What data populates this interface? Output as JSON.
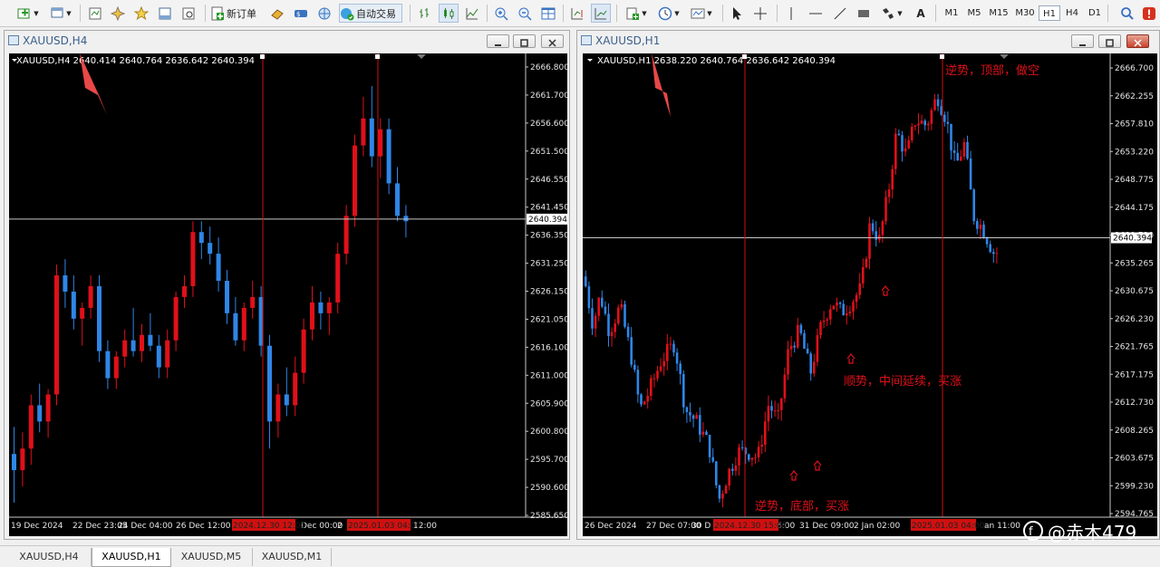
{
  "toolbar": {
    "new_order_label": "新订单",
    "auto_trading_label": "自动交易",
    "timeframes": [
      "M1",
      "M5",
      "M15",
      "M30",
      "H1",
      "H4",
      "D1"
    ],
    "active_timeframe": "H1",
    "text_tool_label": "A"
  },
  "left_window": {
    "title": "XAUUSD,H4",
    "info_line": "XAUUSD,H4  2640.414 2640.764 2636.642 2640.394",
    "current_price": "2640.394",
    "price_ticks": [
      "2666.800",
      "2661.700",
      "2656.600",
      "2651.500",
      "2646.550",
      "2641.450",
      "2636.350",
      "2631.250",
      "2626.150",
      "2621.050",
      "2616.100",
      "2611.000",
      "2605.900",
      "2600.800",
      "2595.700",
      "2590.600",
      "2585.650"
    ],
    "time_labels": [
      "19 Dec 2024",
      "22 Dec 23:05",
      "24 Dec 04:00",
      "26 Dec 12:00",
      "Dec 00:00",
      "2",
      "12:00"
    ],
    "vline_labels": [
      "2024.12.30 12:00",
      "2025.01.03 04:00"
    ],
    "y_range": [
      2585.65,
      2668.5
    ],
    "candles": [
      [
        2597,
        2602,
        2588,
        2594
      ],
      [
        2594,
        2601,
        2591,
        2598
      ],
      [
        2598,
        2608,
        2595,
        2606
      ],
      [
        2606,
        2610,
        2601,
        2603
      ],
      [
        2603,
        2609,
        2600,
        2608
      ],
      [
        2608,
        2632,
        2606,
        2630
      ],
      [
        2630,
        2633,
        2624,
        2627
      ],
      [
        2627,
        2630,
        2620,
        2622
      ],
      [
        2622,
        2625,
        2617,
        2624
      ],
      [
        2624,
        2630,
        2622,
        2628
      ],
      [
        2628,
        2630,
        2614,
        2616
      ],
      [
        2616,
        2618,
        2609,
        2611
      ],
      [
        2611,
        2616,
        2609,
        2615
      ],
      [
        2615,
        2620,
        2613,
        2618
      ],
      [
        2618,
        2624,
        2615,
        2616
      ],
      [
        2616,
        2621,
        2614,
        2619
      ],
      [
        2619,
        2623,
        2616,
        2617
      ],
      [
        2617,
        2619,
        2611,
        2613
      ],
      [
        2613,
        2620,
        2611,
        2618
      ],
      [
        2618,
        2627,
        2616,
        2626
      ],
      [
        2626,
        2630,
        2624,
        2628
      ],
      [
        2628,
        2640,
        2626,
        2638
      ],
      [
        2638,
        2640,
        2633,
        2636
      ],
      [
        2636,
        2639,
        2632,
        2634
      ],
      [
        2634,
        2637,
        2627,
        2629
      ],
      [
        2629,
        2631,
        2621,
        2623
      ],
      [
        2623,
        2626,
        2617,
        2618
      ],
      [
        2618,
        2625,
        2616,
        2624
      ],
      [
        2624,
        2629,
        2622,
        2626
      ],
      [
        2626,
        2628,
        2615,
        2617
      ],
      [
        2617,
        2619,
        2598,
        2603
      ],
      [
        2603,
        2610,
        2600,
        2608
      ],
      [
        2608,
        2613,
        2604,
        2606
      ],
      [
        2606,
        2615,
        2604,
        2612
      ],
      [
        2612,
        2622,
        2610,
        2620
      ],
      [
        2620,
        2628,
        2618,
        2625
      ],
      [
        2625,
        2627,
        2620,
        2623
      ],
      [
        2623,
        2626,
        2619,
        2625
      ],
      [
        2625,
        2636,
        2623,
        2634
      ],
      [
        2634,
        2643,
        2632,
        2641
      ],
      [
        2641,
        2656,
        2639,
        2654
      ],
      [
        2654,
        2663,
        2652,
        2659
      ],
      [
        2659,
        2665,
        2650,
        2652
      ],
      [
        2652,
        2659,
        2648,
        2657
      ],
      [
        2657,
        2659,
        2645,
        2647
      ],
      [
        2647,
        2650,
        2640,
        2641
      ],
      [
        2641,
        2643,
        2637,
        2640
      ]
    ]
  },
  "right_window": {
    "title": "XAUUSD,H1",
    "info_line": "XAUUSD,H1  2638.220 2640.764 2636.642 2640.394",
    "current_price": "2640.394",
    "price_ticks": [
      "2666.700",
      "2662.255",
      "2657.810",
      "2653.220",
      "2648.775",
      "2644.175",
      "2639.730",
      "2635.265",
      "2630.675",
      "2626.230",
      "2621.765",
      "2617.175",
      "2612.730",
      "2608.265",
      "2603.675",
      "2599.230",
      "2594.765"
    ],
    "time_labels": [
      "26 Dec 2024",
      "27 Dec 07:00",
      "30 D",
      "6:00",
      "31 Dec 09:00",
      "2 Jan 02:00",
      "an 11:00"
    ],
    "vline_labels": [
      "2024.12.30 15:00",
      "2025.01.03 04:00"
    ],
    "y_range": [
      2594.765,
      2668.5
    ],
    "annotations": {
      "top": "逆势，顶部，做空",
      "middle": "顺势，中间延续，买涨",
      "bottom": "逆势，底部，买涨"
    },
    "waypoints": [
      [
        0,
        2634
      ],
      [
        10,
        2626
      ],
      [
        18,
        2631
      ],
      [
        28,
        2625
      ],
      [
        40,
        2629
      ],
      [
        52,
        2621
      ],
      [
        62,
        2612
      ],
      [
        72,
        2615
      ],
      [
        85,
        2620
      ],
      [
        100,
        2623
      ],
      [
        112,
        2612
      ],
      [
        124,
        2610
      ],
      [
        138,
        2606
      ],
      [
        149,
        2597
      ],
      [
        158,
        2601
      ],
      [
        170,
        2605
      ],
      [
        181,
        2605
      ],
      [
        192,
        2604
      ],
      [
        204,
        2613
      ],
      [
        214,
        2610
      ],
      [
        226,
        2622
      ],
      [
        238,
        2625
      ],
      [
        250,
        2618
      ],
      [
        262,
        2626
      ],
      [
        274,
        2630
      ],
      [
        284,
        2628
      ],
      [
        296,
        2630
      ],
      [
        306,
        2632
      ],
      [
        316,
        2643
      ],
      [
        326,
        2640
      ],
      [
        336,
        2648
      ],
      [
        345,
        2658
      ],
      [
        356,
        2654
      ],
      [
        366,
        2660
      ],
      [
        378,
        2659
      ],
      [
        390,
        2664
      ],
      [
        400,
        2660
      ],
      [
        410,
        2652
      ],
      [
        420,
        2656
      ],
      [
        430,
        2644
      ],
      [
        440,
        2642
      ],
      [
        452,
        2638
      ]
    ]
  },
  "tabs": [
    "XAUUSD,H4",
    "XAUUSD,H1",
    "XAUUSD,M5",
    "XAUUSD,M1"
  ],
  "active_tab": "XAUUSD,H1",
  "watermark": "@赤木479",
  "colors": {
    "bull": "#e0101a",
    "bear": "#2f86e6",
    "annotation": "#e0101a",
    "title_text": "#3a5f8a"
  }
}
